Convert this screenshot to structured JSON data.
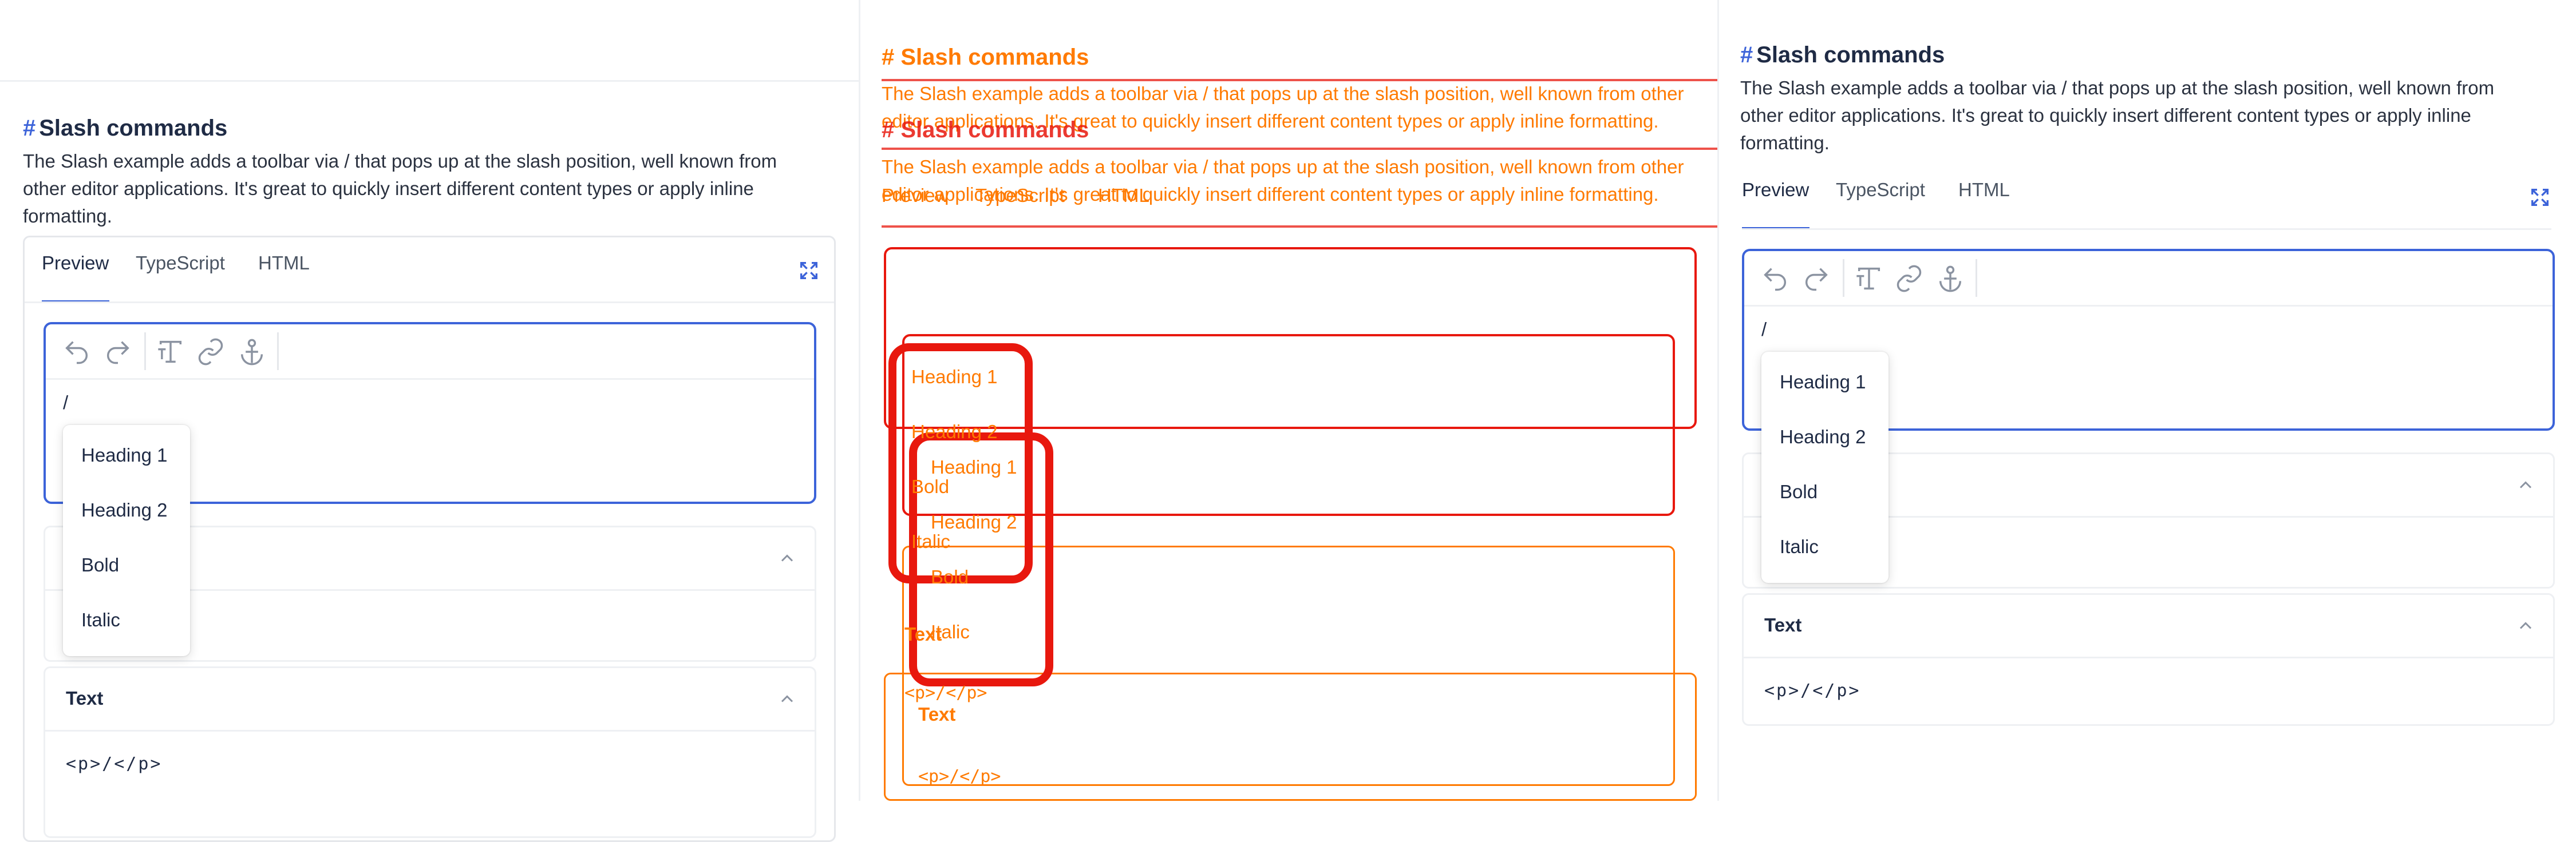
{
  "docs": {
    "title_hash": "#",
    "title": "Slash commands",
    "description": "The Slash example adds a toolbar via / that pops up at the slash position, well known from other editor applications. It's great to quickly insert different content types or apply inline formatting.",
    "tabs": [
      "Preview",
      "TypeScript",
      "HTML"
    ],
    "active_tab": "Preview",
    "editor_content": "/",
    "slash_menu": [
      "Heading 1",
      "Heading 2",
      "Bold",
      "Italic"
    ],
    "accordions": [
      {
        "title": "",
        "body": ""
      },
      {
        "title": "Text",
        "body": "<p>/</p>"
      }
    ]
  },
  "toolbar_icons": [
    "undo-icon",
    "redo-icon",
    "text-format-icon",
    "link-icon",
    "anchor-icon"
  ],
  "icons": {
    "expand": "expand-icon",
    "chevron": "chevron-up-icon"
  },
  "colors": {
    "accent": "#3c63d9",
    "overlay_red": "#e8180e",
    "overlay_orange": "#ff7a00",
    "text": "#1f2b45",
    "muted": "#8b93a1"
  }
}
